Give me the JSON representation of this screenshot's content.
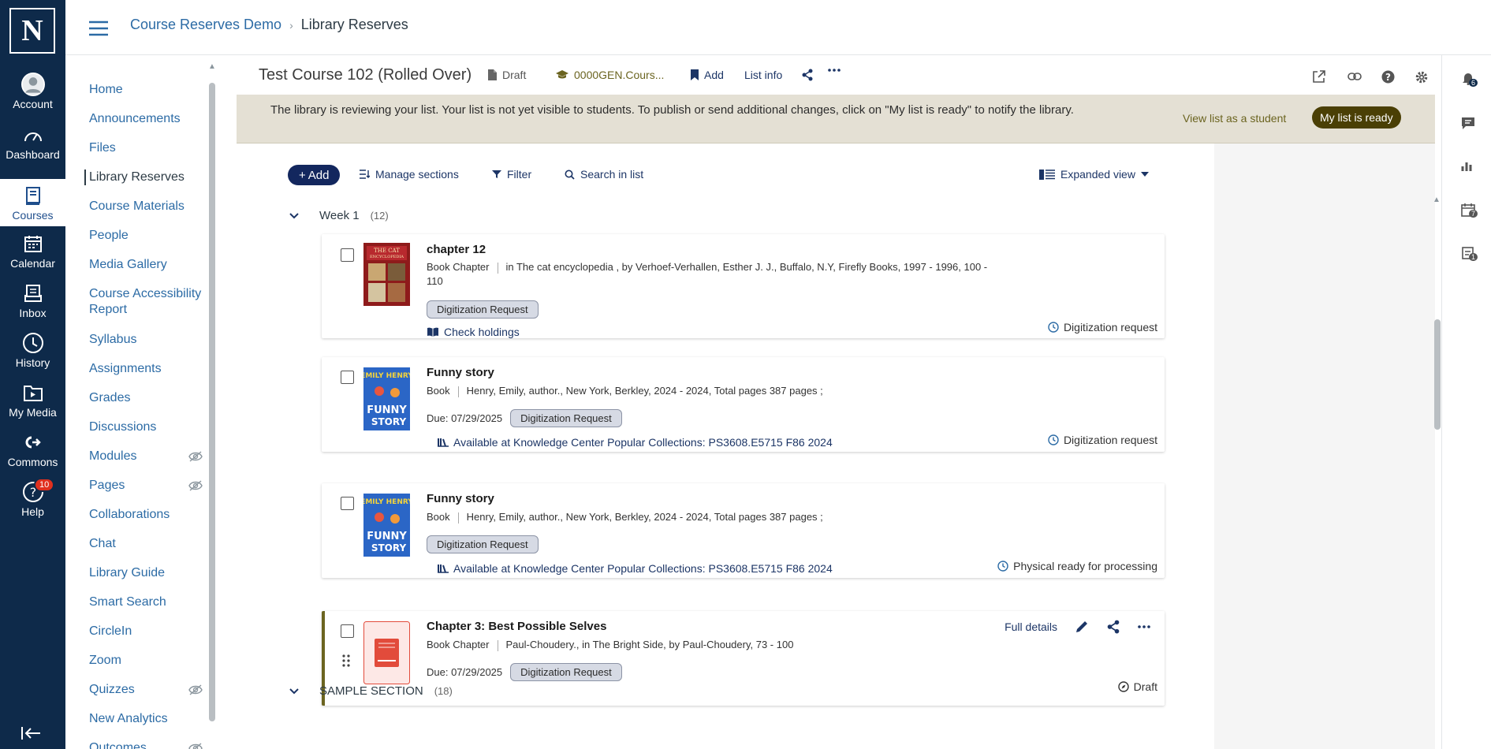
{
  "global_nav": {
    "logo_letter": "N",
    "items": [
      {
        "label": "Account",
        "icon": "account-icon"
      },
      {
        "label": "Dashboard",
        "icon": "dashboard-icon"
      },
      {
        "label": "Courses",
        "icon": "courses-icon",
        "active": true
      },
      {
        "label": "Calendar",
        "icon": "calendar-icon"
      },
      {
        "label": "Inbox",
        "icon": "inbox-icon"
      },
      {
        "label": "History",
        "icon": "history-icon"
      },
      {
        "label": "My Media",
        "icon": "my-media-icon"
      },
      {
        "label": "Commons",
        "icon": "commons-icon"
      },
      {
        "label": "Help",
        "icon": "help-icon",
        "badge": "10"
      }
    ]
  },
  "breadcrumb": {
    "course": "Course Reserves Demo",
    "current": "Library Reserves"
  },
  "course_nav": {
    "items": [
      {
        "label": "Home"
      },
      {
        "label": "Announcements"
      },
      {
        "label": "Files"
      },
      {
        "label": "Library Reserves",
        "active": true
      },
      {
        "label": "Course Materials"
      },
      {
        "label": "People"
      },
      {
        "label": "Media Gallery"
      },
      {
        "label": "Course Accessibility Report"
      },
      {
        "label": "Syllabus"
      },
      {
        "label": "Assignments"
      },
      {
        "label": "Grades"
      },
      {
        "label": "Discussions"
      },
      {
        "label": "Modules",
        "hidden": true
      },
      {
        "label": "Pages",
        "hidden": true
      },
      {
        "label": "Collaborations"
      },
      {
        "label": "Chat"
      },
      {
        "label": "Library Guide"
      },
      {
        "label": "Smart Search"
      },
      {
        "label": "CircleIn"
      },
      {
        "label": "Zoom"
      },
      {
        "label": "Quizzes",
        "hidden": true
      },
      {
        "label": "New Analytics"
      },
      {
        "label": "Outcomes",
        "hidden": true
      }
    ]
  },
  "list_header": {
    "title": "Test Course 102 (Rolled Over)",
    "status": "Draft",
    "course_code": "0000GEN.Cours...",
    "add_label": "Add",
    "list_info_label": "List info"
  },
  "notice": {
    "text": "The library is reviewing your list. Your list is not yet visible to students. To publish or send additional changes, click on \"My list is ready\" to notify the library.",
    "view_student": "View list as a student",
    "ready_button": "My list is ready"
  },
  "actions": {
    "add": "Add",
    "manage_sections": "Manage sections",
    "filter": "Filter",
    "search": "Search in list",
    "view": "Expanded view"
  },
  "week": {
    "label": "Week 1",
    "count": "(12)"
  },
  "section2": {
    "label": "SAMPLE SECTION",
    "count": "(18)"
  },
  "cards": [
    {
      "title": "chapter 12",
      "type": "Book Chapter",
      "meta": "in The cat encyclopedia , by Verhoef-Verhallen, Esther J. J., Buffalo, N.Y, Firefly Books, 1997 - 1996, 100 - 110",
      "badge": "Digitization Request",
      "link": "Check holdings",
      "status": "Digitization request"
    },
    {
      "title": "Funny story",
      "type": "Book",
      "meta": "Henry, Emily, author., New York, Berkley, 2024 - 2024, Total pages 387 pages ;",
      "due": "Due: 07/29/2025",
      "badge": "Digitization Request",
      "link": "Available at Knowledge Center Popular Collections: PS3608.E5715 F86 2024",
      "status": "Digitization request"
    },
    {
      "title": "Funny story",
      "type": "Book",
      "meta": "Henry, Emily, author., New York, Berkley, 2024 - 2024, Total pages 387 pages ;",
      "badge": "Digitization Request",
      "link": "Available at Knowledge Center Popular Collections: PS3608.E5715 F86 2024",
      "status": "Physical ready for processing"
    },
    {
      "title": "Chapter 3: Best Possible Selves",
      "type": "Book Chapter",
      "meta": "Paul-Choudery., in The Bright Side, by Paul-Choudery, 73 - 100",
      "due": "Due: 07/29/2025",
      "badge": "Digitization Request",
      "full_details": "Full details",
      "status": "Draft"
    }
  ],
  "right_rail": {
    "notifications_badge": "6",
    "calendar_badge": "7",
    "tasks_badge": "1"
  },
  "colors": {
    "nav_bg": "#0e2a4a",
    "link": "#2c6ba5",
    "ready_button": "#4a3f05",
    "notice_bg": "#e4e0d4"
  }
}
